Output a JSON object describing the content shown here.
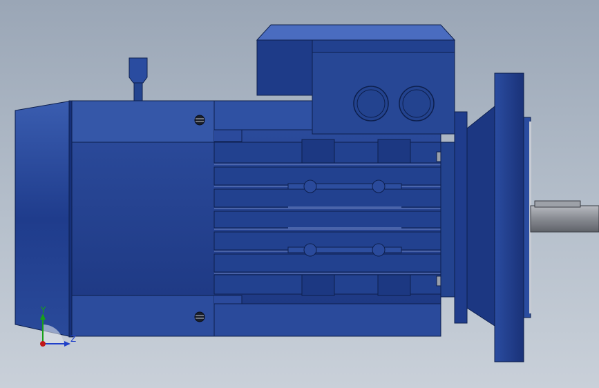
{
  "window": {
    "title": ""
  },
  "viewport": {
    "background_top": "#9aa6b6",
    "background_bottom": "#c9d0d9"
  },
  "model": {
    "name": "electric-motor-with-flange",
    "body_color": "#1f3c8c",
    "body_highlight": "#3557a8",
    "shaft_color": "#8c8f96"
  },
  "triad": {
    "y_label": "Y",
    "z_label": "Z",
    "y_color": "#18a018",
    "z_color": "#2040c8",
    "origin_color": "#c01818"
  }
}
